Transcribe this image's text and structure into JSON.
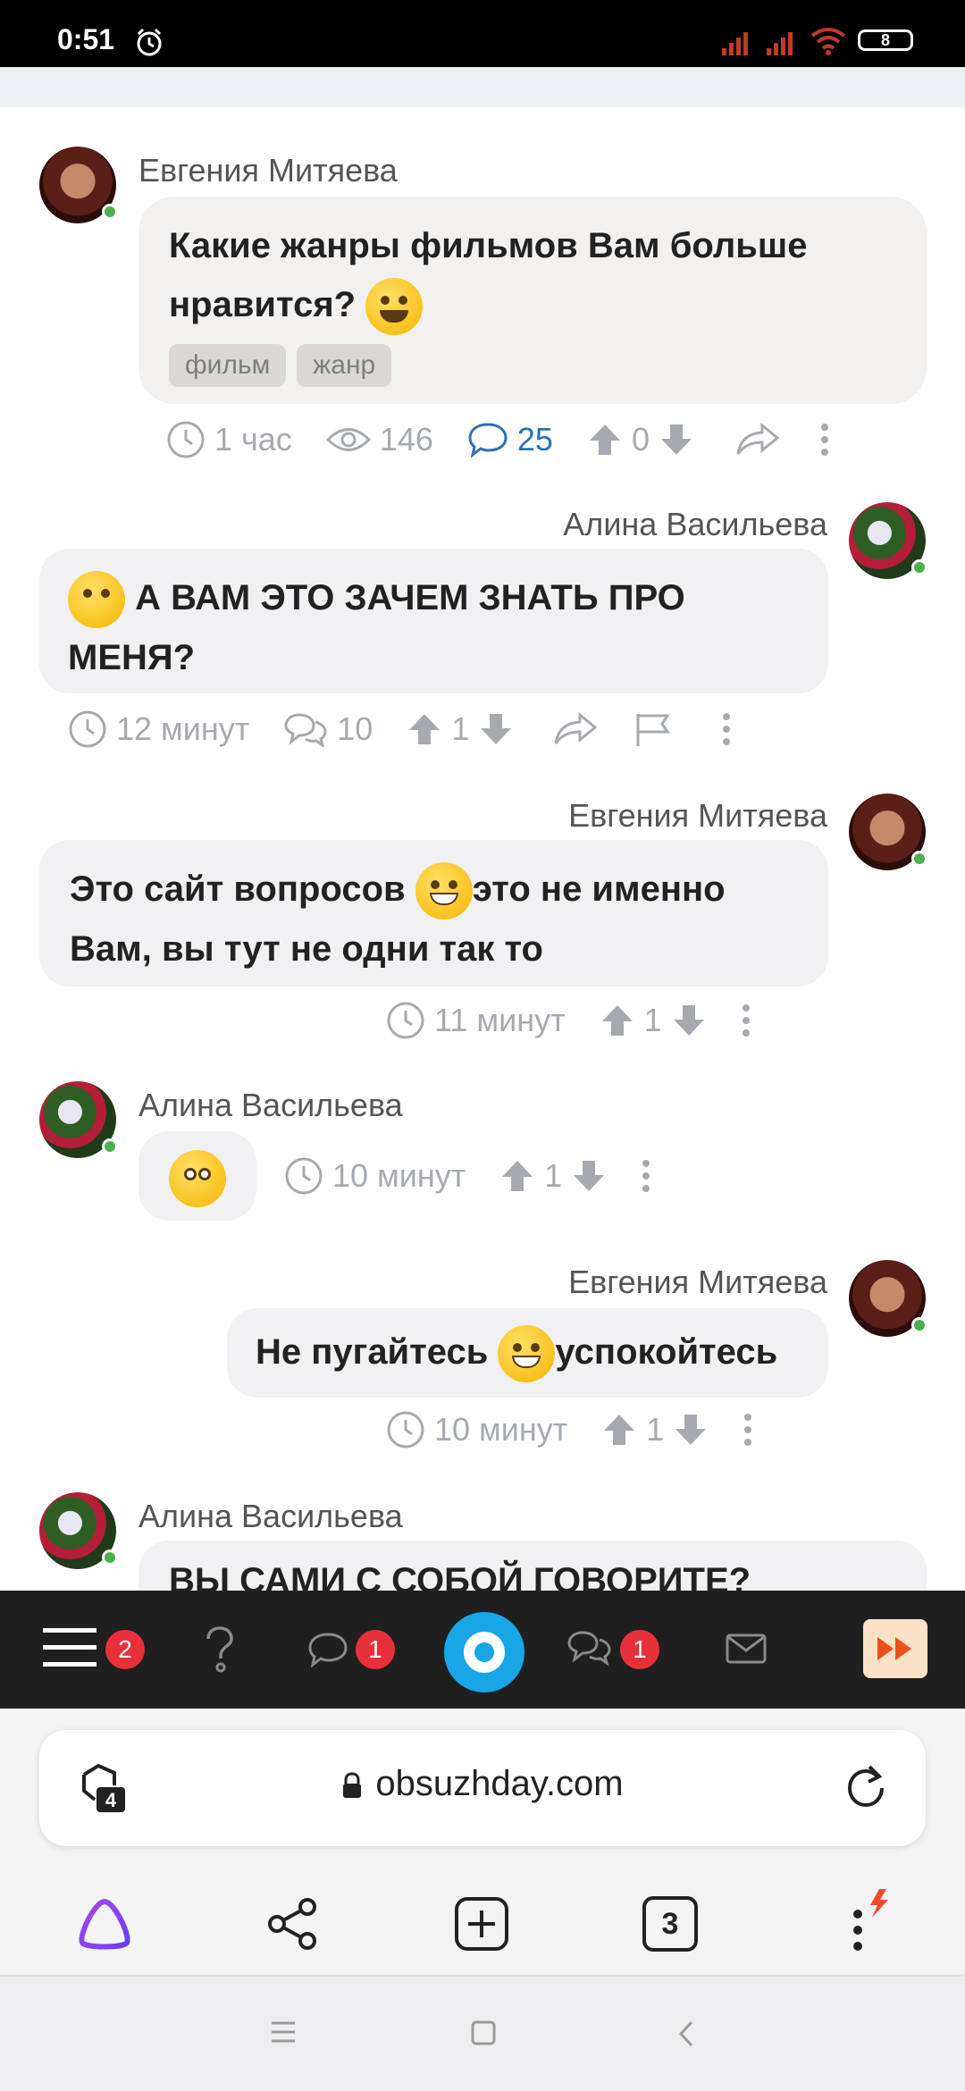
{
  "status_bar": {
    "time": "0:51",
    "battery": "8"
  },
  "question": {
    "author": "Евгения Митяева",
    "text": "Какие жанры фильмов Вам больше нравится?",
    "tags": [
      "фильм",
      "жанр"
    ],
    "time": "1 час",
    "views": "146",
    "comments": "25",
    "votes": "0"
  },
  "comments": [
    {
      "author": "Алина Васильева",
      "text": "А ВАМ ЭТО ЗАЧЕМ ЗНАТЬ ПРО МЕНЯ?",
      "time": "12 минут",
      "replies": "10",
      "votes": "1"
    },
    {
      "author": "Евгения Митяева",
      "text_a": "Это сайт вопросов",
      "text_b": "это не именно Вам, вы тут не одни так то",
      "time": "11 минут",
      "votes": "1"
    },
    {
      "author": "Алина Васильева",
      "time": "10 минут",
      "votes": "1"
    },
    {
      "author": "Евгения Митяева",
      "text_a": "Не пугайтесь",
      "text_b": "успокойтесь",
      "time": "10 минут",
      "votes": "1"
    },
    {
      "author": "Алина Васильева",
      "text": "ВЫ САМИ С СОБОЙ ГОВОРИТЕ?"
    }
  ],
  "site_nav": {
    "menu_badge": "2",
    "chat_badge": "1",
    "messages_badge": "1"
  },
  "browser": {
    "url": "obsuzhday.com",
    "tabs_count": "4",
    "open_tabs": "3"
  }
}
